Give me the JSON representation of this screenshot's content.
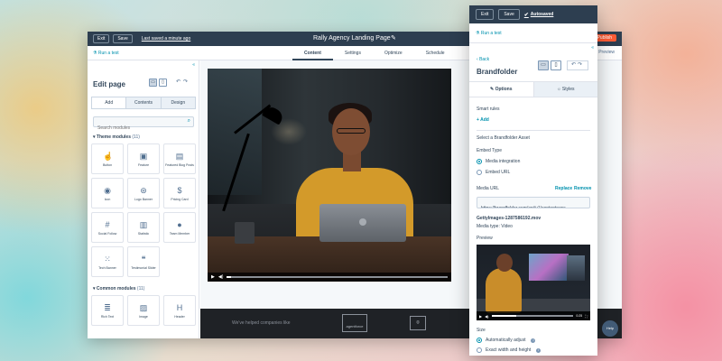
{
  "editor": {
    "exit_label": "Exit",
    "save_label": "Save",
    "saved_status": "Last saved a minute ago",
    "title": "Rally Agency Landing Page",
    "publish_label": "Publish",
    "run_test": "Run a test",
    "tabs": [
      "Content",
      "Settings",
      "Optimize",
      "Schedule"
    ],
    "active_tab": "Content",
    "preview_label": "Preview"
  },
  "sidebar": {
    "title": "Edit page",
    "tabs": [
      "Add",
      "Contents",
      "Design"
    ],
    "search_placeholder": "Search modules",
    "theme_modules": {
      "label": "Theme modules",
      "count": "(11)"
    },
    "theme_items": [
      {
        "label": "Button",
        "icon": "cursor-icon"
      },
      {
        "label": "Feature",
        "icon": "image-icon"
      },
      {
        "label": "Featured Blog Posts",
        "icon": "blog-icon"
      },
      {
        "label": "Icon",
        "icon": "target-icon"
      },
      {
        "label": "Logo Banner",
        "icon": "logo-icon"
      },
      {
        "label": "Pricing Card",
        "icon": "dollar-icon"
      },
      {
        "label": "Social Follow",
        "icon": "hashtag-icon"
      },
      {
        "label": "Statistic",
        "icon": "chart-icon"
      },
      {
        "label": "Team Member",
        "icon": "person-icon"
      },
      {
        "label": "Tech Banner",
        "icon": "grid-icon"
      },
      {
        "label": "Testimonial Slider",
        "icon": "quote-icon"
      }
    ],
    "common_modules": {
      "label": "Common modules",
      "count": "(11)"
    },
    "common_items": [
      {
        "label": "Rich Text",
        "icon": "text-icon"
      },
      {
        "label": "Image",
        "icon": "image-icon"
      },
      {
        "label": "Header",
        "icon": "header-icon"
      }
    ]
  },
  "canvas": {
    "strip_text": "We've helped companies like",
    "strip_logo": "agentforce"
  },
  "panel": {
    "exit_label": "Exit",
    "save_label": "Save",
    "autosaved": "Autosaved",
    "run_test": "Run a test",
    "back": "Back",
    "title": "Brandfolder",
    "tab_options": "Options",
    "tab_styles": "Styles",
    "smart_rules": "Smart rules",
    "add": "Add",
    "select_asset": "Select a Brandfolder Asset",
    "embed_type": "Embed Type",
    "embed_options": [
      "Media integration",
      "Embed URL"
    ],
    "embed_selected": "Media integration",
    "media_url_label": "Media URL",
    "replace": "Replace",
    "remove": "Remove",
    "media_url_value": "https://brandfolder.com/api/v1/contentsync",
    "file_name": "GettyImages-1287586192.mov",
    "media_type": "Media type:  Video",
    "preview_label": "Preview",
    "preview_time": "0:25",
    "size_label": "Size",
    "size_options": [
      "Automatically adjust",
      "Exact width and height"
    ],
    "size_selected": "Automatically adjust",
    "help_label": "Help"
  },
  "colors": {
    "topbar": "#2d3e50",
    "accent": "#0091ae",
    "publish": "#ff5c35"
  }
}
